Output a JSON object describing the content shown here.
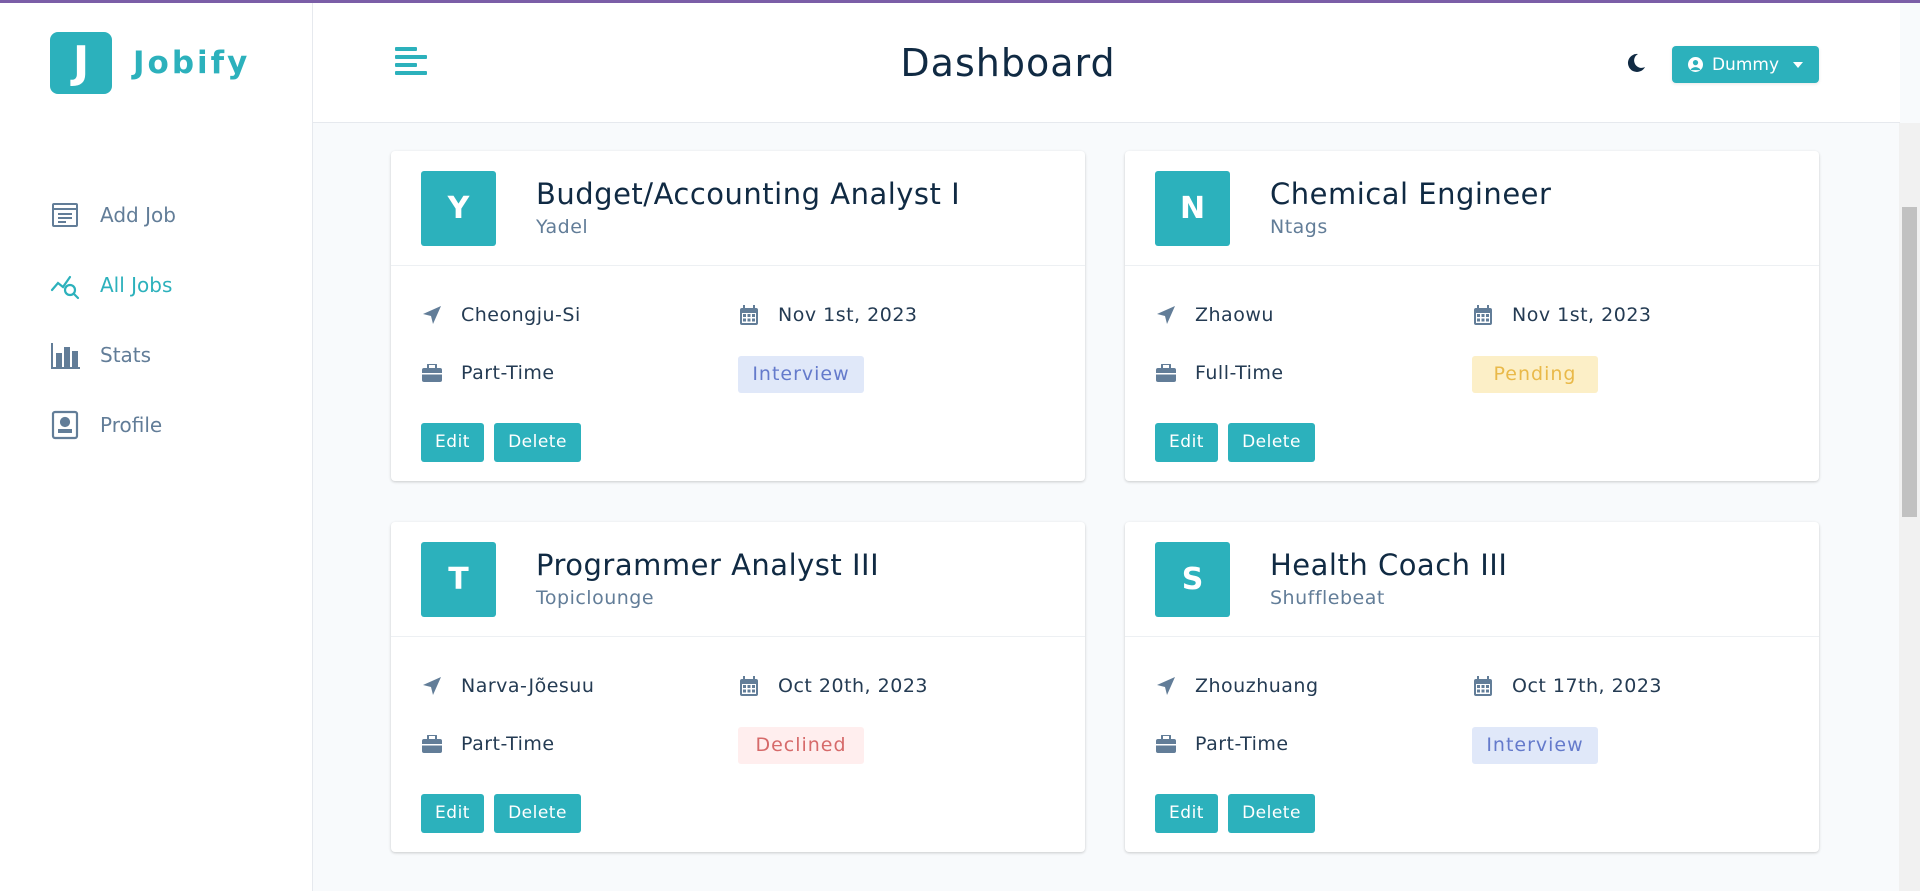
{
  "app": {
    "logo_letter": "J",
    "logo_name": "Jobify"
  },
  "sidebar": {
    "items": [
      {
        "label": "Add Job",
        "icon": "add-job-form-icon",
        "active": false
      },
      {
        "label": "All Jobs",
        "icon": "all-jobs-chart-search-icon",
        "active": true
      },
      {
        "label": "Stats",
        "icon": "bar-chart-icon",
        "active": false
      },
      {
        "label": "Profile",
        "icon": "profile-id-card-icon",
        "active": false
      }
    ]
  },
  "navbar": {
    "title": "Dashboard",
    "user_name": "Dummy",
    "theme_icon": "moon-icon"
  },
  "colors": {
    "accent": "#2cb1bc",
    "interview_bg": "#e0e8f9",
    "interview_fg": "#647acb",
    "pending_bg": "#fcefc7",
    "pending_fg": "#e9b949",
    "declined_bg": "#ffeeee",
    "declined_fg": "#d66a6a"
  },
  "jobs": [
    {
      "initial": "Y",
      "position": "Budget/Accounting Analyst I",
      "company": "Yadel",
      "location": "Cheongju-Si",
      "date": "Nov 1st, 2023",
      "type": "Part-Time",
      "status": "Interview",
      "edit_label": "Edit",
      "delete_label": "Delete"
    },
    {
      "initial": "N",
      "position": "Chemical Engineer",
      "company": "Ntags",
      "location": "Zhaowu",
      "date": "Nov 1st, 2023",
      "type": "Full-Time",
      "status": "Pending",
      "edit_label": "Edit",
      "delete_label": "Delete"
    },
    {
      "initial": "T",
      "position": "Programmer Analyst III",
      "company": "Topiclounge",
      "location": "Narva-Jõesuu",
      "date": "Oct 20th, 2023",
      "type": "Part-Time",
      "status": "Declined",
      "edit_label": "Edit",
      "delete_label": "Delete"
    },
    {
      "initial": "S",
      "position": "Health Coach III",
      "company": "Shufflebeat",
      "location": "Zhouzhuang",
      "date": "Oct 17th, 2023",
      "type": "Part-Time",
      "status": "Interview",
      "edit_label": "Edit",
      "delete_label": "Delete"
    }
  ]
}
